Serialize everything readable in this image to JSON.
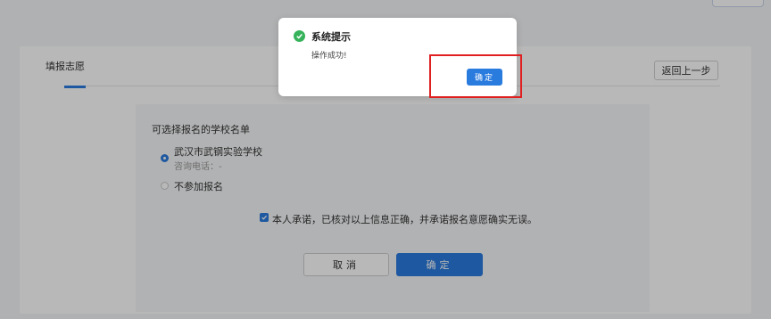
{
  "page": {
    "card_title": "填报志愿",
    "back_label": "返回上一步",
    "section_label": "可选择报名的学校名单",
    "options": [
      {
        "name": "武汉市武钢实验学校",
        "sub": "咨询电话：-",
        "checked": true
      },
      {
        "name": "不参加报名",
        "checked": false
      }
    ],
    "agreement": "本人承诺，已核对以上信息正确，并承诺报名意愿确实无误。",
    "cancel_label": "取消",
    "confirm_label": "确定"
  },
  "dialog": {
    "title": "系统提示",
    "message": "操作成功!",
    "ok_label": "确定",
    "icon": "check-circle-icon"
  },
  "colors": {
    "accent": "#2a7bde",
    "success": "#36b35a",
    "highlight": "#e02020"
  }
}
